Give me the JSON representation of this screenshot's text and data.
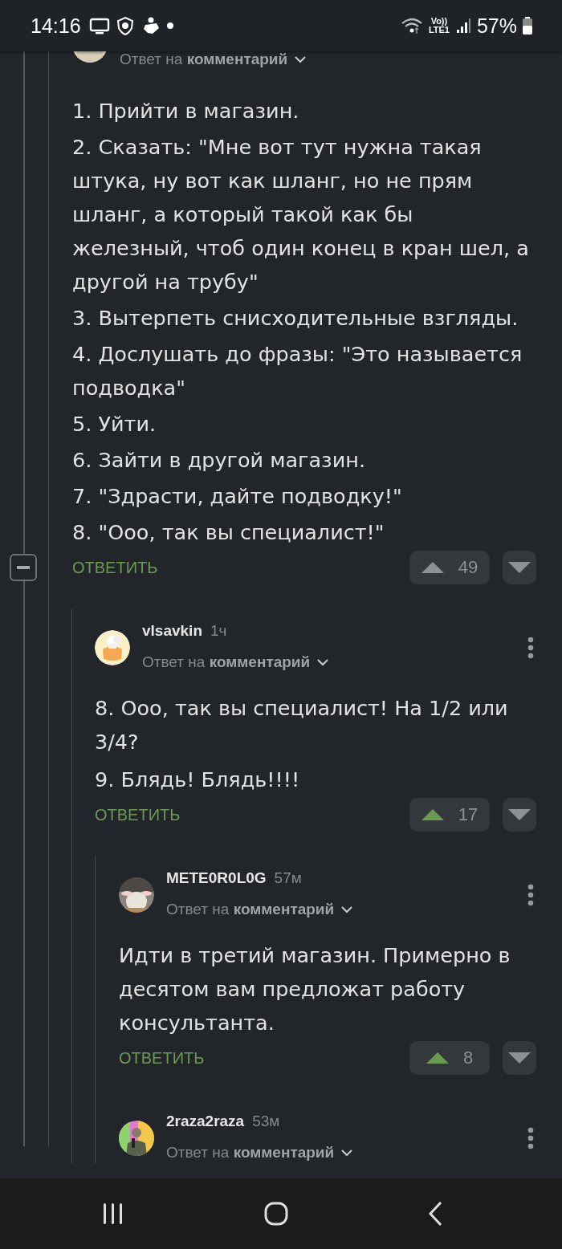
{
  "status_bar": {
    "time": "14:16",
    "network": [
      "Vo))",
      "LTE1"
    ],
    "battery": "57%"
  },
  "comment": {
    "reply_to": "Ответ на **комментарий**",
    "body": {
      "kind": "list",
      "items": [
        "1. Прийти в магазин.",
        "2. Сказать: \"Мне вот тут нужна такая штука, ну вот как шланг, но не прям шланг, а который такой как бы железный, чтоб один конец в кран шел, а другой на трубу\"",
        "3. Вытерпеть снисходительные взгляды.",
        "4. Дослушать до фразы: \"Это называется подводка\"",
        "5. Уйти.",
        "6. Зайти в другой магазин.",
        "7. \"Здрасти, дайте подводку!\"",
        "8. \"Ооо, так вы специалист!\""
      ]
    },
    "reply_label": "ОТВЕТИТЬ",
    "rating": "49",
    "upvoted": false,
    "replies": [
      {
        "author": "vlsavkin",
        "time": "1ч",
        "reply_to": "Ответ на **комментарий**",
        "body": {
          "kind": "paragraphs",
          "items": [
            "8. Ооо, так вы специалист! На 1/2 или 3/4?",
            "9. Блядь! Блядь!!!!"
          ]
        },
        "reply_label": "ОТВЕТИТЬ",
        "rating": "17",
        "upvoted": true,
        "replies": [
          {
            "author": "METE0R0L0G",
            "time": "57м",
            "reply_to": "Ответ на **комментарий**",
            "body": {
              "kind": "paragraphs",
              "items": [
                "Идти в третий магазин. Примерно в десятом вам предложат работу консультанта."
              ]
            },
            "reply_label": "ОТВЕТИТЬ",
            "rating": "8",
            "upvoted": true
          },
          {
            "author": "2raza2raza",
            "time": "53м",
            "reply_to": "Ответ на **комментарий**"
          }
        ]
      }
    ]
  }
}
